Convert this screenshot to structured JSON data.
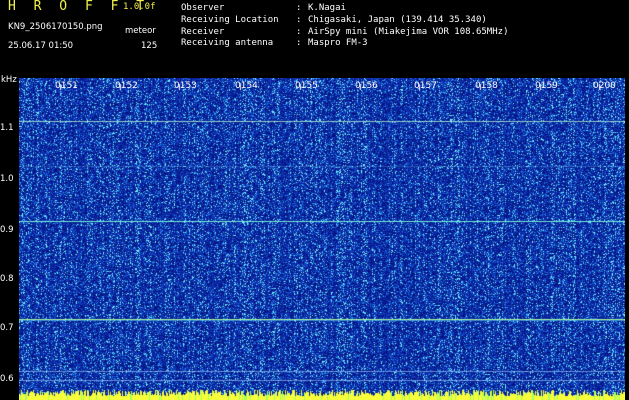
{
  "header": {
    "brand": "H R O F F T",
    "version": "1.0.0f",
    "filename": "KN9_2506170150.png",
    "mode": "meteor",
    "datetime": "25.06.17 01:50",
    "count": "125",
    "meta": [
      {
        "label": "Observer",
        "sep": ":",
        "value": "K.Nagai"
      },
      {
        "label": "Receiving Location",
        "sep": ":",
        "value": "Chigasaki, Japan (139.414 35.340)"
      },
      {
        "label": "Receiver",
        "sep": ":",
        "value": "AirSpy mini (Miakejima VOR 108.65MHz)"
      },
      {
        "label": "Receiving antenna",
        "sep": ":",
        "value": "Maspro FM-3"
      }
    ]
  },
  "spectrogram": {
    "unit": "kHz",
    "y_ticks": [
      "1.1",
      "1.0",
      "0.9",
      "0.8",
      "0.7",
      "0.6"
    ],
    "x_ticks": [
      "0151",
      "0152",
      "0153",
      "0154",
      "0155",
      "0156",
      "0157",
      "0158",
      "0159",
      "0200"
    ],
    "colors": {
      "background": "#0a1a9a",
      "noise_high": "#6ff0ff",
      "trace": "#9cffd0",
      "footer": "#f6ff3a"
    }
  }
}
